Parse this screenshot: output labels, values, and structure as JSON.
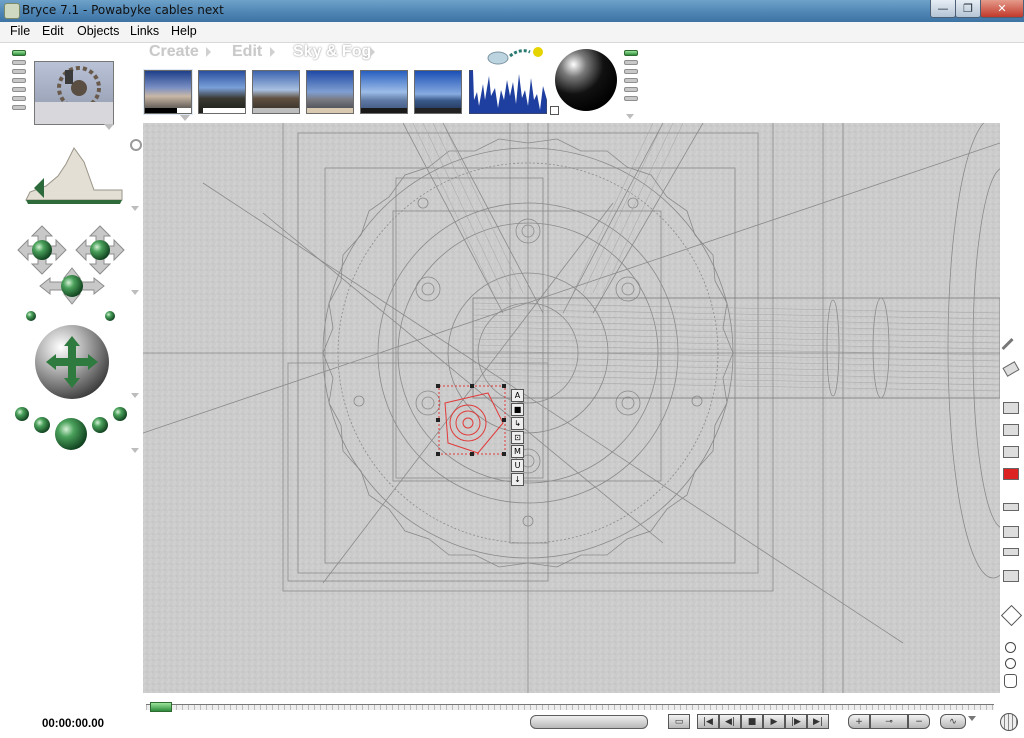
{
  "window": {
    "title": "Bryce 7.1  - Powabyke cables next",
    "controls": {
      "minimize": "—",
      "maximize": "❐",
      "close": "✕"
    }
  },
  "menu": [
    "File",
    "Edit",
    "Objects",
    "Links",
    "Help"
  ],
  "modes": {
    "create": "Create",
    "edit": "Edit",
    "sky_fog": "Sky & Fog",
    "active": "Sky & Fog"
  },
  "sky_presets": [
    {
      "name": "preset-1",
      "selected": true
    },
    {
      "name": "preset-2",
      "selected": false
    },
    {
      "name": "preset-3",
      "selected": false
    },
    {
      "name": "preset-4",
      "selected": false
    },
    {
      "name": "preset-5",
      "selected": false
    },
    {
      "name": "preset-6",
      "selected": false
    }
  ],
  "selection_tools": [
    "A",
    "■",
    "↳",
    "⊡",
    "M",
    "U",
    "↓"
  ],
  "timeline": {
    "time": "00:00:00.00"
  },
  "colors": {
    "accent_red": "#e23a3a",
    "green_sphere": "#3b8a4a"
  }
}
